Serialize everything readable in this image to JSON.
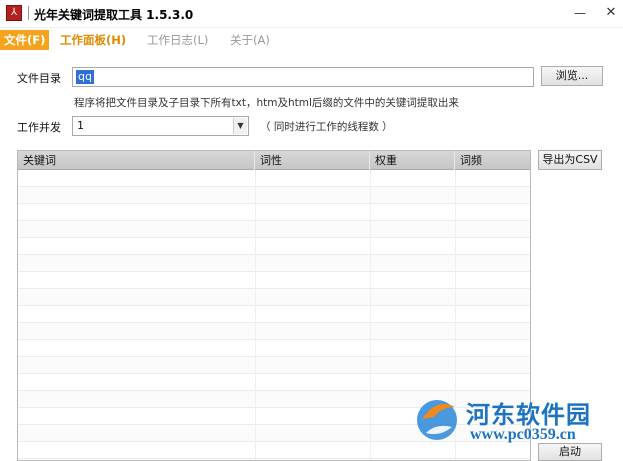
{
  "window": {
    "title": "光年关键词提取工具 1.5.3.0",
    "icon": "app-logo-icon",
    "minimize_glyph": "—",
    "close_glyph": "✕"
  },
  "menu": {
    "items": [
      {
        "label": "文件(F)",
        "active": true
      },
      {
        "label": "工作面板(H)",
        "active": false
      },
      {
        "label": "工作日志(L)",
        "active": false
      },
      {
        "label": "关于(A)",
        "active": false
      }
    ]
  },
  "form": {
    "directory_label": "文件目录",
    "directory_value": "qq",
    "browse_label": "浏览...",
    "hint": "程序将把文件目录及子目录下所有txt，htm及html后缀的文件中的关键词提取出来",
    "concurrency_label": "工作并发",
    "concurrency_value": "1",
    "concurrency_note": "（ 同时进行工作的线程数 ）"
  },
  "table": {
    "columns": [
      "关键词",
      "词性",
      "权重",
      "词频"
    ],
    "rows": []
  },
  "actions": {
    "export_label": "导出为CSV",
    "start_label": "启动"
  },
  "watermark": {
    "name": "河东软件园",
    "url": "www.pc0359.cn"
  },
  "colors": {
    "menu_active_bg": "#f5a31a",
    "menu_highlight": "#e08a00",
    "selection": "#2f6fd6",
    "watermark": "#1c73c2"
  }
}
